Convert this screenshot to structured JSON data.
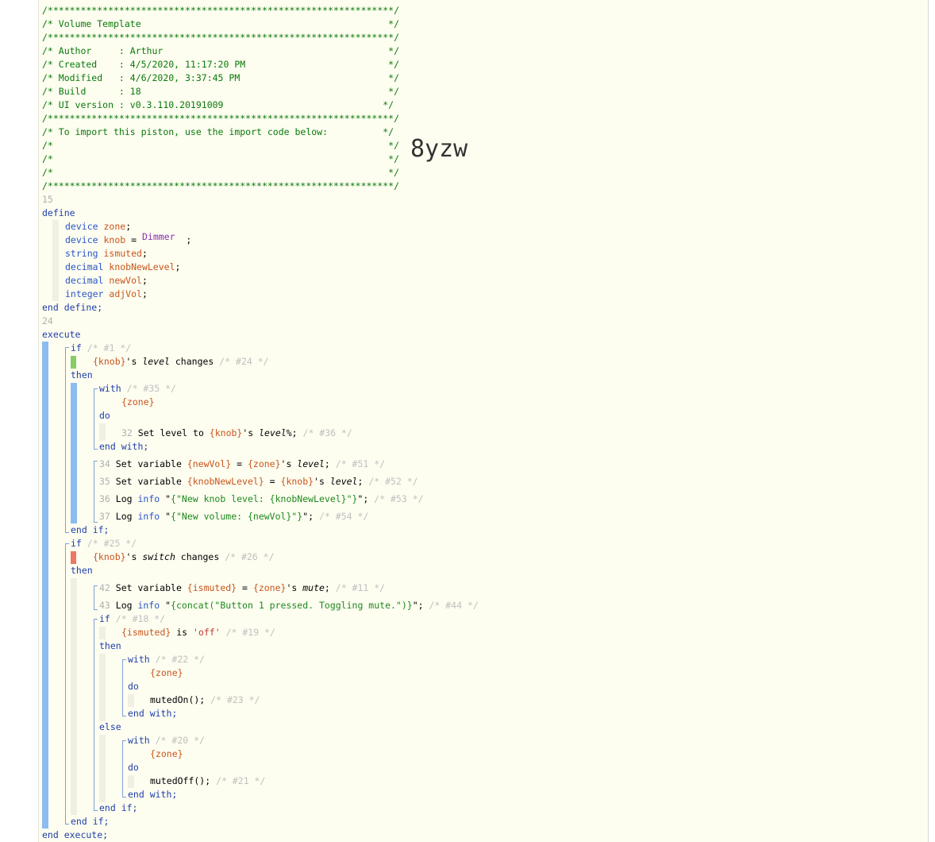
{
  "header": {
    "rule": "/***************************************************************/",
    "title": "/* Volume Template                                             */",
    "author": "/* Author     : Arthur                                         */",
    "created": "/* Created    : 4/5/2020, 11:17:20 PM                          */",
    "modified": "/* Modified   : 4/6/2020, 3:37:45 PM                           */",
    "build": "/* Build      : 18                                             */",
    "ui_version": "/* UI version : v0.3.110.20191009                             */",
    "import_note": "/* To import this piston, use the import code below:          */",
    "blank": "/*                                                             */"
  },
  "import_code": "8yzw",
  "define": {
    "line_no": "15",
    "keyword": "define",
    "end": "end define;",
    "vars": [
      {
        "type": "device",
        "name": "zone",
        "suffix": ";"
      },
      {
        "type": "device",
        "name": "knob",
        "suffix": " = ",
        "value": "Dimmer",
        "end": ";"
      },
      {
        "type": "string",
        "name": "ismuted",
        "suffix": ";"
      },
      {
        "type": "decimal",
        "name": "knobNewLevel",
        "suffix": ";"
      },
      {
        "type": "decimal",
        "name": "newVol",
        "suffix": ";"
      },
      {
        "type": "integer",
        "name": "adjVol",
        "suffix": ";"
      }
    ]
  },
  "execute": {
    "line_no": "24",
    "keyword": "execute",
    "end": "end execute;",
    "if1": {
      "kw": "if",
      "cmt": "/* #1 */",
      "cond_dev": "{knob}",
      "cond_mid": "'s ",
      "cond_attr": "level",
      "cond_op": " changes ",
      "cond_cmt": "/* #24 */",
      "then": "then",
      "with_kw": "with",
      "with_cmt": "/* #35 */",
      "with_dev": "{zone}",
      "do": "do",
      "stmt1": {
        "no": "32",
        "a": " Set level to ",
        "v": "{knob}",
        "b": "'s ",
        "attr": "level%",
        "c": "; ",
        "cmt": "/* #36 */"
      },
      "end_with": "end with;",
      "s34": {
        "no": "34",
        "a": " Set variable ",
        "v": "{newVol}",
        "b": " = ",
        "d": "{zone}",
        "c": "'s ",
        "attr": "level",
        "e": "; ",
        "cmt": "/* #51 */"
      },
      "s35": {
        "no": "35",
        "a": " Set variable ",
        "v": "{knobNewLevel}",
        "b": " = ",
        "d": "{knob}",
        "c": "'s ",
        "attr": "level",
        "e": "; ",
        "cmt": "/* #52 */"
      },
      "s36": {
        "no": "36",
        "a": " Log ",
        "lvl": "info",
        "b": " \"",
        "str": "{\"New knob level: {knobNewLevel}\"}",
        "c": "\"; ",
        "cmt": "/* #53 */"
      },
      "s37": {
        "no": "37",
        "a": " Log ",
        "lvl": "info",
        "b": " \"",
        "str": "{\"New volume: {newVol}\"}",
        "c": "\"; ",
        "cmt": "/* #54 */"
      },
      "end_if": "end if;"
    },
    "if2": {
      "kw": "if",
      "cmt": "/* #25 */",
      "cond_dev": "{knob}",
      "cond_mid": "'s ",
      "cond_attr": "switch",
      "cond_op": " changes ",
      "cond_cmt": "/* #26 */",
      "then": "then",
      "s42": {
        "no": "42",
        "a": " Set variable ",
        "v": "{ismuted}",
        "b": " = ",
        "d": "{zone}",
        "c": "'s ",
        "attr": "mute",
        "e": "; ",
        "cmt": "/* #11 */"
      },
      "s43": {
        "no": "43",
        "a": " Log ",
        "lvl": "info",
        "b": " \"",
        "str": "{concat(\"Button 1 pressed. Toggling mute.\")}",
        "c": "\"; ",
        "cmt": "/* #44 */"
      },
      "inner_if": {
        "kw": "if",
        "cmt": "/* #18 */",
        "cond_v": "{ismuted}",
        "cond_op": " is ",
        "cond_val": "'off'",
        "cond_cmt": "/* #19 */",
        "then": "then",
        "w1_kw": "with",
        "w1_cmt": "/* #22 */",
        "w1_dev": "{zone}",
        "w1_do": "do",
        "w1_stmt": "mutedOn(); ",
        "w1_stmt_cmt": "/* #23 */",
        "w1_end": "end with;",
        "else": "else",
        "w2_kw": "with",
        "w2_cmt": "/* #20 */",
        "w2_dev": "{zone}",
        "w2_do": "do",
        "w2_stmt": "mutedOff(); ",
        "w2_stmt_cmt": "/* #21 */",
        "w2_end": "end with;",
        "end_if": "end if;"
      },
      "end_if": "end if;"
    }
  }
}
